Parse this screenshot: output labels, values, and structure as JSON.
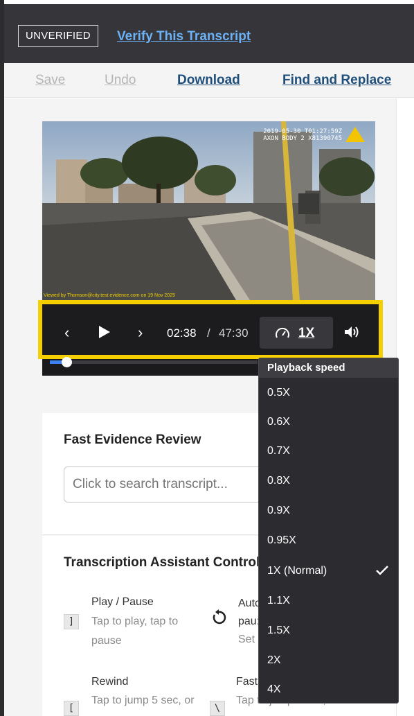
{
  "topbar": {
    "status_badge": "UNVERIFIED",
    "verify_link": "Verify This Transcript"
  },
  "toolbar": {
    "save": "Save",
    "undo": "Undo",
    "download": "Download",
    "find_replace": "Find and Replace"
  },
  "video": {
    "stamp_line1": "2019-05-30 T01:27:59Z",
    "stamp_line2": "AXON BODY 2 X81390745",
    "watermark": "Viewed by Thomson@city.test.evidence.com on 19 Nov 2025",
    "current_time": "02:38",
    "separator": "/",
    "duration": "47:30",
    "speed": "1X",
    "progress_fraction": 0.055
  },
  "speed_menu": {
    "header": "Playback speed",
    "options": [
      "0.5X",
      "0.6X",
      "0.7X",
      "0.8X",
      "0.9X",
      "0.95X",
      "1X (Normal)",
      "1.1X",
      "1.5X",
      "2X",
      "4X"
    ],
    "selected": "1X (Normal)"
  },
  "fast_review": {
    "title": "Fast Evidence Review",
    "search_placeholder": "Click to search transcript..."
  },
  "assistant": {
    "title": "Transcription Assistant Controls",
    "shortcuts": [
      {
        "key": "]",
        "title": "Play / Pause",
        "desc1": "Tap to play, tap to",
        "desc2": "pause"
      },
      {
        "key": "",
        "title": "Autc",
        "desc1": "pau:",
        "desc2": "Set"
      },
      {
        "key": "[",
        "title": "Rewind",
        "desc1": "Tap to jump 5 sec, or",
        "desc2": ""
      },
      {
        "key": "\\",
        "title": "Fast",
        "desc1": "Tap to jump 5 sec, or",
        "desc2": ""
      }
    ]
  },
  "colors": {
    "highlight": "#f5cf00",
    "link_blue": "#6cb1f5",
    "toolbar_link": "#1e4e79",
    "progress": "#3b82f6"
  }
}
